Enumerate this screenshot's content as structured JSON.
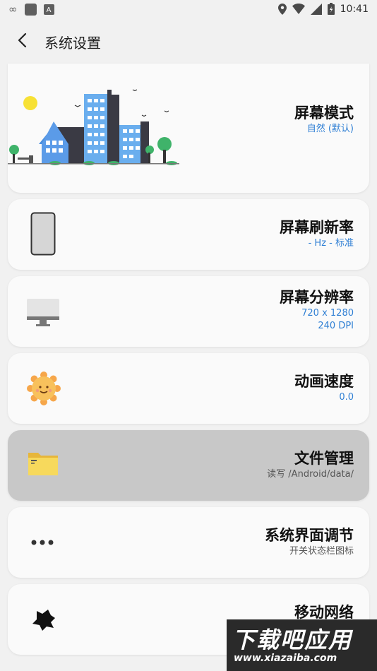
{
  "status_bar": {
    "time": "10:41"
  },
  "appbar": {
    "title": "系统设置"
  },
  "items": [
    {
      "title": "屏幕模式",
      "subtitle": "自然 (默认)"
    },
    {
      "title": "屏幕刷新率",
      "subtitle": "- Hz - 标准"
    },
    {
      "title": "屏幕分辨率",
      "subtitle": "720 x 1280",
      "subtitle2": "240 DPI"
    },
    {
      "title": "动画速度",
      "subtitle": "0.0"
    },
    {
      "title": "文件管理",
      "subtitle": "读写 /Android/data/"
    },
    {
      "title": "系统界面调节",
      "subtitle": "开关状态栏图标"
    },
    {
      "title": "移动网络",
      "subtitle": ""
    }
  ],
  "watermark": {
    "line1": "下载吧应用",
    "line2": "www.xiazaiba.com"
  }
}
